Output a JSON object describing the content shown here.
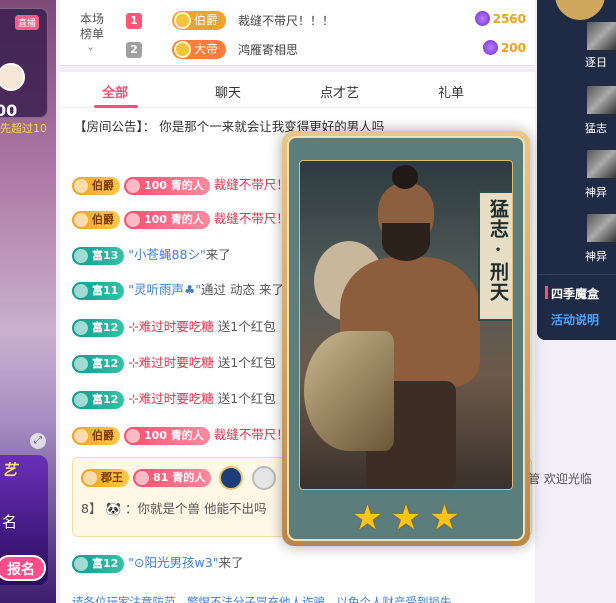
{
  "left": {
    "live_tag": "直播",
    "count": "00",
    "over_text": "先超过10",
    "banner_title": "艺",
    "signup_label": "名",
    "signup_button": "报名"
  },
  "rank": {
    "label": "本场 榜单",
    "rows": [
      {
        "no": "1",
        "no_color": "#ff5577",
        "badge": "伯爵",
        "badge_color": "#f3a12b",
        "name": "裁缝不带尺！！！",
        "score": "2560"
      },
      {
        "no": "2",
        "no_color": "#a0a0a0",
        "badge": "大帝",
        "badge_color": "#ff7d3c",
        "name": "鸿雁寄相思",
        "score": "200"
      }
    ]
  },
  "tabs": [
    {
      "label": "全部",
      "active": true
    },
    {
      "label": "聊天",
      "active": false
    },
    {
      "label": "点才艺",
      "active": false
    },
    {
      "label": "礼单",
      "active": false
    }
  ],
  "notice": "【房间公告】： 你是那个一来就会让我变得更好的男人吗",
  "messages": [
    {
      "badge": "伯爵",
      "badge_class": "lvl-noble",
      "extra": "100 青的人",
      "user": "裁缝不带尺！",
      "text": ""
    },
    {
      "badge": "伯爵",
      "badge_class": "lvl-noble",
      "extra": "100 青的人",
      "user": "裁缝不带尺！",
      "text": ""
    },
    {
      "badge": "富13",
      "badge_class": "lvl-fu",
      "user": "\"小苍蝇88シ\"",
      "text": "来了"
    },
    {
      "badge": "富11",
      "badge_class": "lvl-fu",
      "user": "\"灵听雨声♣\"",
      "text": "通过 动态 来了"
    },
    {
      "badge": "富12",
      "badge_class": "lvl-fu",
      "user": "⊹难过时要吃糖",
      "text": " 送1个红包"
    },
    {
      "badge": "富12",
      "badge_class": "lvl-fu",
      "user": "⊹难过时要吃糖",
      "text": " 送1个红包"
    },
    {
      "badge": "富12",
      "badge_class": "lvl-fu",
      "user": "⊹难过时要吃糖",
      "text": " 送1个红包"
    },
    {
      "badge": "伯爵",
      "badge_class": "lvl-noble",
      "extra": "100 青的人",
      "user": "裁缝不带尺！",
      "text": ""
    }
  ],
  "big_message": {
    "badge": "郡王",
    "extra": "81 青的人",
    "welcome": "管 欢迎光临",
    "prefix": "8】",
    "text": "：你就是个兽 他能不出吗"
  },
  "last_message": {
    "badge": "富12",
    "user": "\"⊙阳光男孩w3\"",
    "text": "来了"
  },
  "footer_tip": "请各位玩家注意防范，警惕不法分子冒充他人诈骗，以免个人财产受到损失",
  "right": {
    "names": [
      "逐日",
      "猛志",
      "神异",
      "神异"
    ],
    "event_title": "四季魔盒",
    "event_link": "活动说明"
  },
  "hero": {
    "title": "猛志·刑天",
    "stars": 3
  }
}
